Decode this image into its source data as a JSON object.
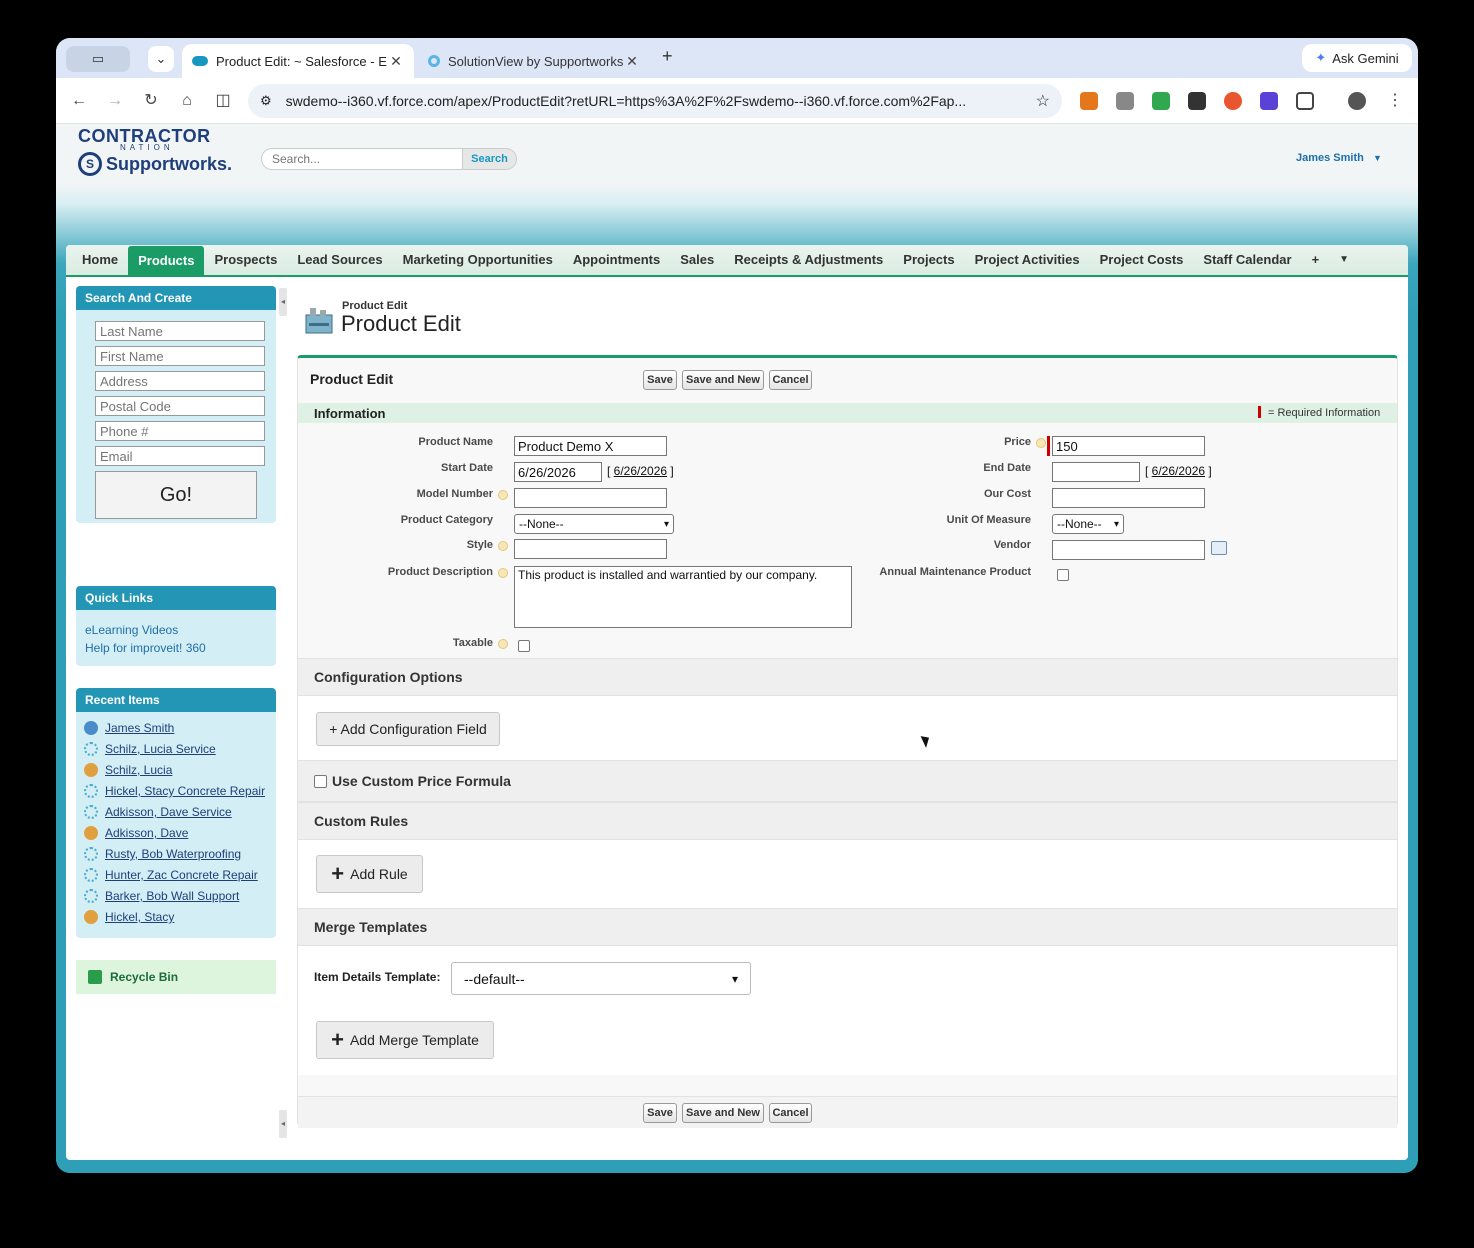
{
  "browser": {
    "active_tab_title": "Product Edit: ~ Salesforce - E",
    "second_tab_title": "SolutionView by Supportworks",
    "ask_gemini": "Ask Gemini",
    "url": "swdemo--i360.vf.force.com/apex/ProductEdit?retURL=https%3A%2F%2Fswdemo--i360.vf.force.com%2Fap..."
  },
  "header": {
    "logo_line1": "CONTRACTOR",
    "logo_line2": "NATION",
    "logo_line3": "Supportworks.",
    "search_placeholder": "Search...",
    "search_button": "Search",
    "user_name": "James Smith"
  },
  "nav_tabs": [
    "Home",
    "Products",
    "Prospects",
    "Lead Sources",
    "Marketing Opportunities",
    "Appointments",
    "Sales",
    "Receipts & Adjustments",
    "Projects",
    "Project Activities",
    "Project Costs",
    "Staff Calendar"
  ],
  "sidebar": {
    "search_create_title": "Search And Create",
    "inputs": [
      "Last Name",
      "First Name",
      "Address",
      "Postal Code",
      "Phone #",
      "Email"
    ],
    "go_label": "Go!",
    "quick_links_title": "Quick Links",
    "quick_links": [
      "eLearning Videos",
      "Help for improveit! 360"
    ],
    "recent_title": "Recent Items",
    "recent_items": [
      {
        "label": "James Smith",
        "icon": "person-icon"
      },
      {
        "label": "Schilz, Lucia Service",
        "icon": "gear-icon"
      },
      {
        "label": "Schilz, Lucia",
        "icon": "people-icon"
      },
      {
        "label": "Hickel, Stacy Concrete Repair",
        "icon": "gear-icon"
      },
      {
        "label": "Adkisson, Dave Service",
        "icon": "gear-icon"
      },
      {
        "label": "Adkisson, Dave",
        "icon": "people-icon"
      },
      {
        "label": "Rusty, Bob Waterproofing",
        "icon": "gear-icon"
      },
      {
        "label": "Hunter, Zac Concrete Repair",
        "icon": "gear-icon"
      },
      {
        "label": "Barker, Bob Wall Support",
        "icon": "gear-icon"
      },
      {
        "label": "Hickel, Stacy",
        "icon": "people-icon"
      }
    ],
    "recycle_bin": "Recycle Bin"
  },
  "page": {
    "small_title": "Product Edit",
    "title": "Product Edit"
  },
  "form": {
    "block_title": "Product Edit",
    "save": "Save",
    "save_new": "Save and New",
    "cancel": "Cancel",
    "info_title": "Information",
    "required_info": "= Required Information",
    "labels": {
      "product_name": "Product Name",
      "start_date": "Start Date",
      "model_number": "Model Number",
      "product_category": "Product Category",
      "style": "Style",
      "product_description": "Product Description",
      "taxable": "Taxable",
      "price": "Price",
      "end_date": "End Date",
      "our_cost": "Our Cost",
      "unit_of_measure": "Unit Of Measure",
      "vendor": "Vendor",
      "annual_maintenance": "Annual Maintenance Product"
    },
    "values": {
      "product_name": "Product Demo X",
      "start_date": "6/26/2026",
      "start_date_link": "6/26/2026",
      "end_date_link": "6/26/2026",
      "product_category": "--None--",
      "product_description": "This product is installed and warrantied by our company.",
      "price": "150",
      "unit_of_measure": "--None--"
    },
    "config_title": "Configuration Options",
    "add_config_field": "+ Add Configuration Field",
    "custom_price_formula": "Use Custom Price Formula",
    "custom_rules_title": "Custom Rules",
    "add_rule": "Add Rule",
    "merge_title": "Merge Templates",
    "item_details_label": "Item Details Template:",
    "item_details_value": "--default--",
    "add_merge_template": "Add Merge Template"
  },
  "colors": {
    "tab_green": "#1b9c67",
    "sidebar_head": "#2396b6",
    "link_blue": "#1f6fa8"
  }
}
